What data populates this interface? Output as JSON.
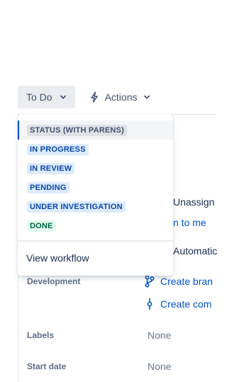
{
  "toolbar": {
    "status_label": "To Do",
    "actions_label": "Actions"
  },
  "dropdown": {
    "items": [
      {
        "label": "STATUS (WITH PARENS)",
        "color": "#42526e",
        "bg": "#dfe1e6"
      },
      {
        "label": "IN PROGRESS",
        "color": "#0747a6",
        "bg": "#deebff"
      },
      {
        "label": "IN REVIEW",
        "color": "#0747a6",
        "bg": "#deebff"
      },
      {
        "label": "PENDING",
        "color": "#0747a6",
        "bg": "#deebff"
      },
      {
        "label": "UNDER INVESTIGATION",
        "color": "#0747a6",
        "bg": "#deebff"
      },
      {
        "label": "DONE",
        "color": "#006644",
        "bg": "#e3fcef"
      }
    ],
    "view_workflow": "View workflow"
  },
  "details": {
    "assignee_value": "Unassign",
    "assign_to_me": "n to me",
    "automation_value": "Automatic",
    "development_label": "Development",
    "create_branch": "Create bran",
    "create_commit": "Create com",
    "labels_label": "Labels",
    "labels_value": "None",
    "start_date_label": "Start date",
    "start_date_value": "None"
  },
  "colors": {
    "accent": "#0052cc",
    "text": "#172b4d",
    "muted": "#6b778c"
  }
}
